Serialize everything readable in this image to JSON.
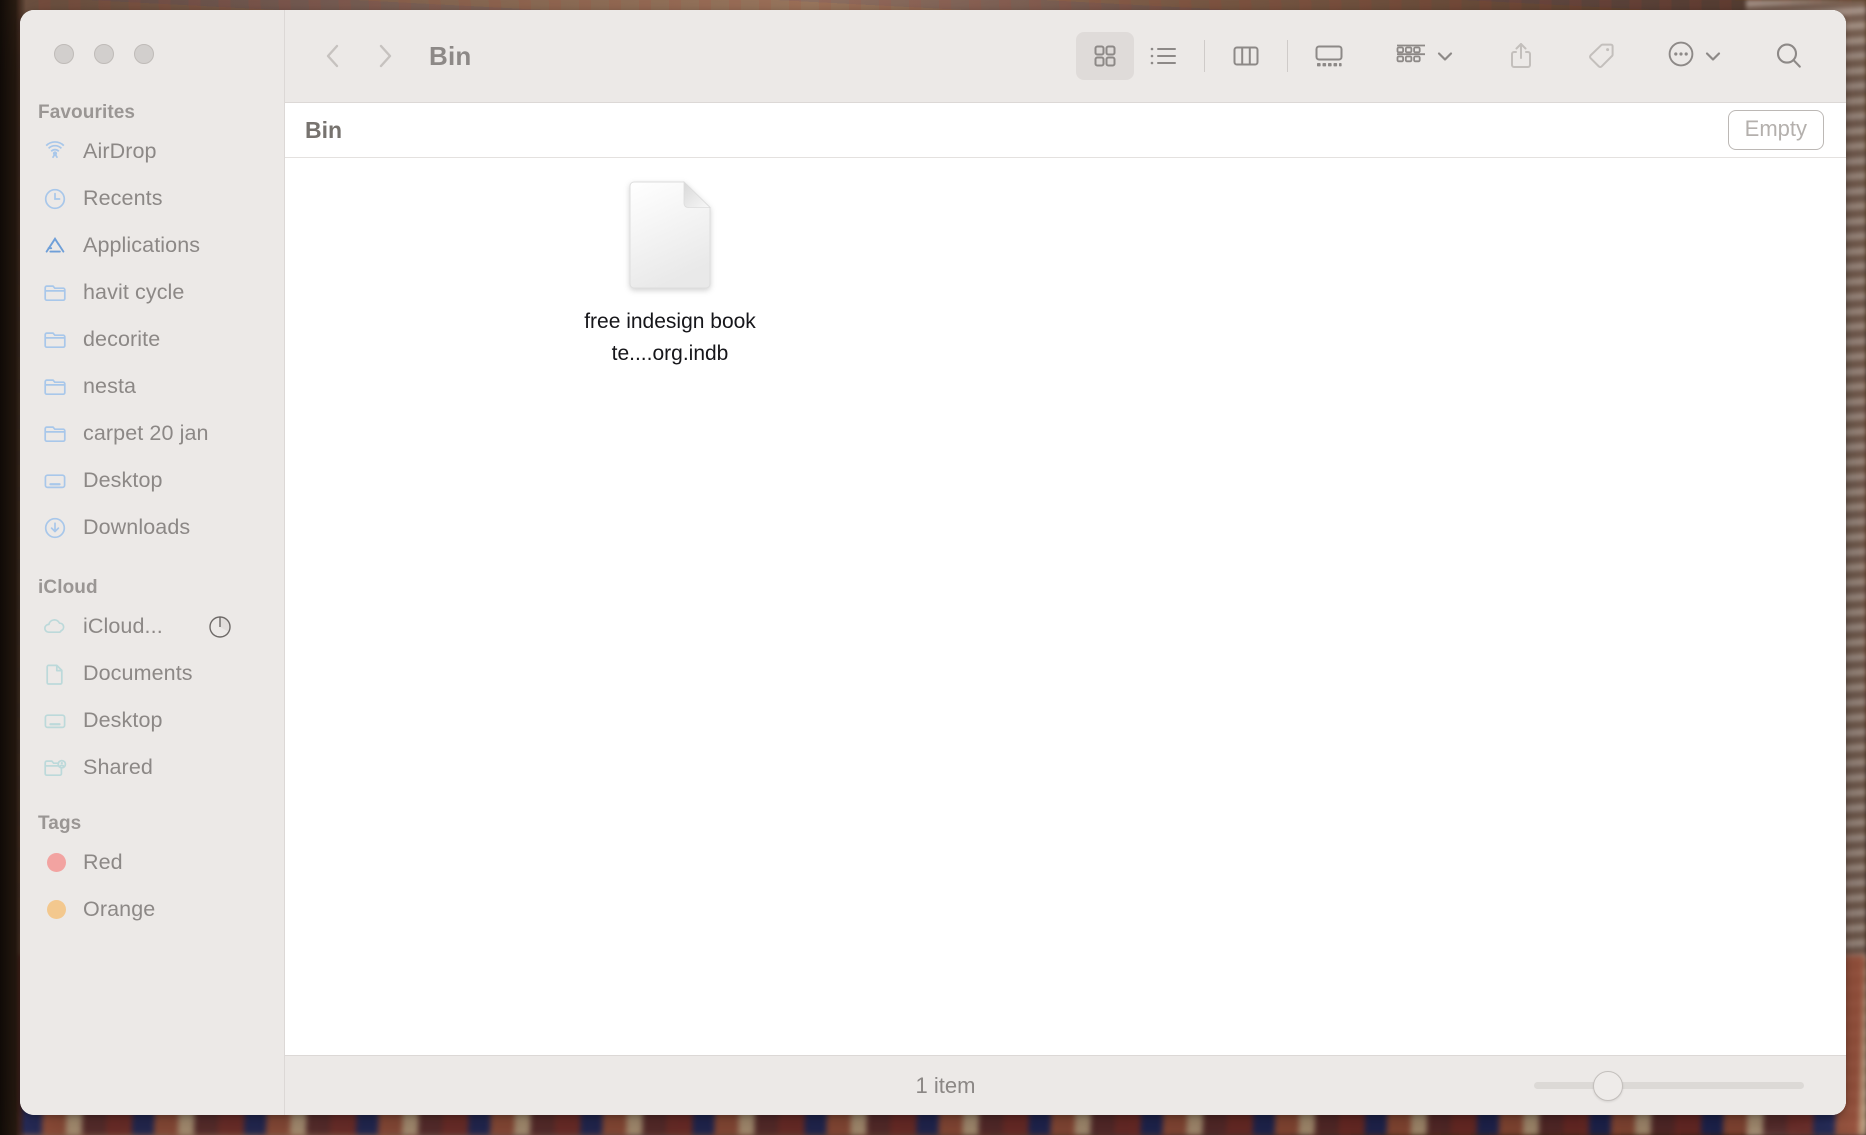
{
  "window": {
    "title": "Bin",
    "traffic_lights": [
      "close",
      "minimize",
      "maximize"
    ]
  },
  "toolbar": {
    "back_label": "Back",
    "forward_label": "Forward",
    "view_icon_label": "Icon view",
    "view_list_label": "List view",
    "view_column_label": "Column view",
    "view_gallery_label": "Gallery view",
    "group_label": "Group",
    "share_label": "Share",
    "tag_label": "Tags",
    "more_label": "More",
    "search_label": "Search",
    "selected_view": "icon"
  },
  "bin_header": {
    "title": "Bin",
    "empty_label": "Empty"
  },
  "sidebar": {
    "sections": [
      {
        "title": "Favourites",
        "items": [
          {
            "label": "AirDrop",
            "icon": "airdrop-icon",
            "tint": "blue"
          },
          {
            "label": "Recents",
            "icon": "clock-icon",
            "tint": "blue"
          },
          {
            "label": "Applications",
            "icon": "applications-icon",
            "tint": "blue"
          },
          {
            "label": "havit cycle",
            "icon": "folder-icon",
            "tint": "blue"
          },
          {
            "label": "decorite",
            "icon": "folder-icon",
            "tint": "blue"
          },
          {
            "label": "nesta",
            "icon": "folder-icon",
            "tint": "blue"
          },
          {
            "label": "carpet 20 jan",
            "icon": "folder-icon",
            "tint": "blue"
          },
          {
            "label": "Desktop",
            "icon": "desktop-icon",
            "tint": "blue"
          },
          {
            "label": "Downloads",
            "icon": "downloads-icon",
            "tint": "blue"
          }
        ]
      },
      {
        "title": "iCloud",
        "items": [
          {
            "label": "iCloud...",
            "icon": "cloud-icon",
            "tint": "teal",
            "badge": "sync-progress"
          },
          {
            "label": "Documents",
            "icon": "document-icon",
            "tint": "teal"
          },
          {
            "label": "Desktop",
            "icon": "desktop-icon",
            "tint": "teal"
          },
          {
            "label": "Shared",
            "icon": "shared-folder-icon",
            "tint": "teal"
          }
        ]
      },
      {
        "title": "Tags",
        "items": [
          {
            "label": "Red",
            "icon": "tag-dot-icon",
            "color": "#f2a3a1"
          },
          {
            "label": "Orange",
            "icon": "tag-dot-icon",
            "color": "#f3c88e"
          }
        ]
      }
    ]
  },
  "content": {
    "files": [
      {
        "name": "free indesign book te....org.indb",
        "icon": "blank-document-icon"
      }
    ]
  },
  "status": {
    "item_count_label": "1 item",
    "zoom_value": 22
  },
  "colors": {
    "sidebar_bg": "#ece9e7",
    "toolbar_bg": "#ece9e7",
    "content_bg": "#ffffff",
    "icon_blue": "#a8c7ea",
    "icon_teal": "#bcd9da",
    "text_gray": "#8c8886",
    "tag_red": "#f2a3a1",
    "tag_orange": "#f3c88e"
  }
}
